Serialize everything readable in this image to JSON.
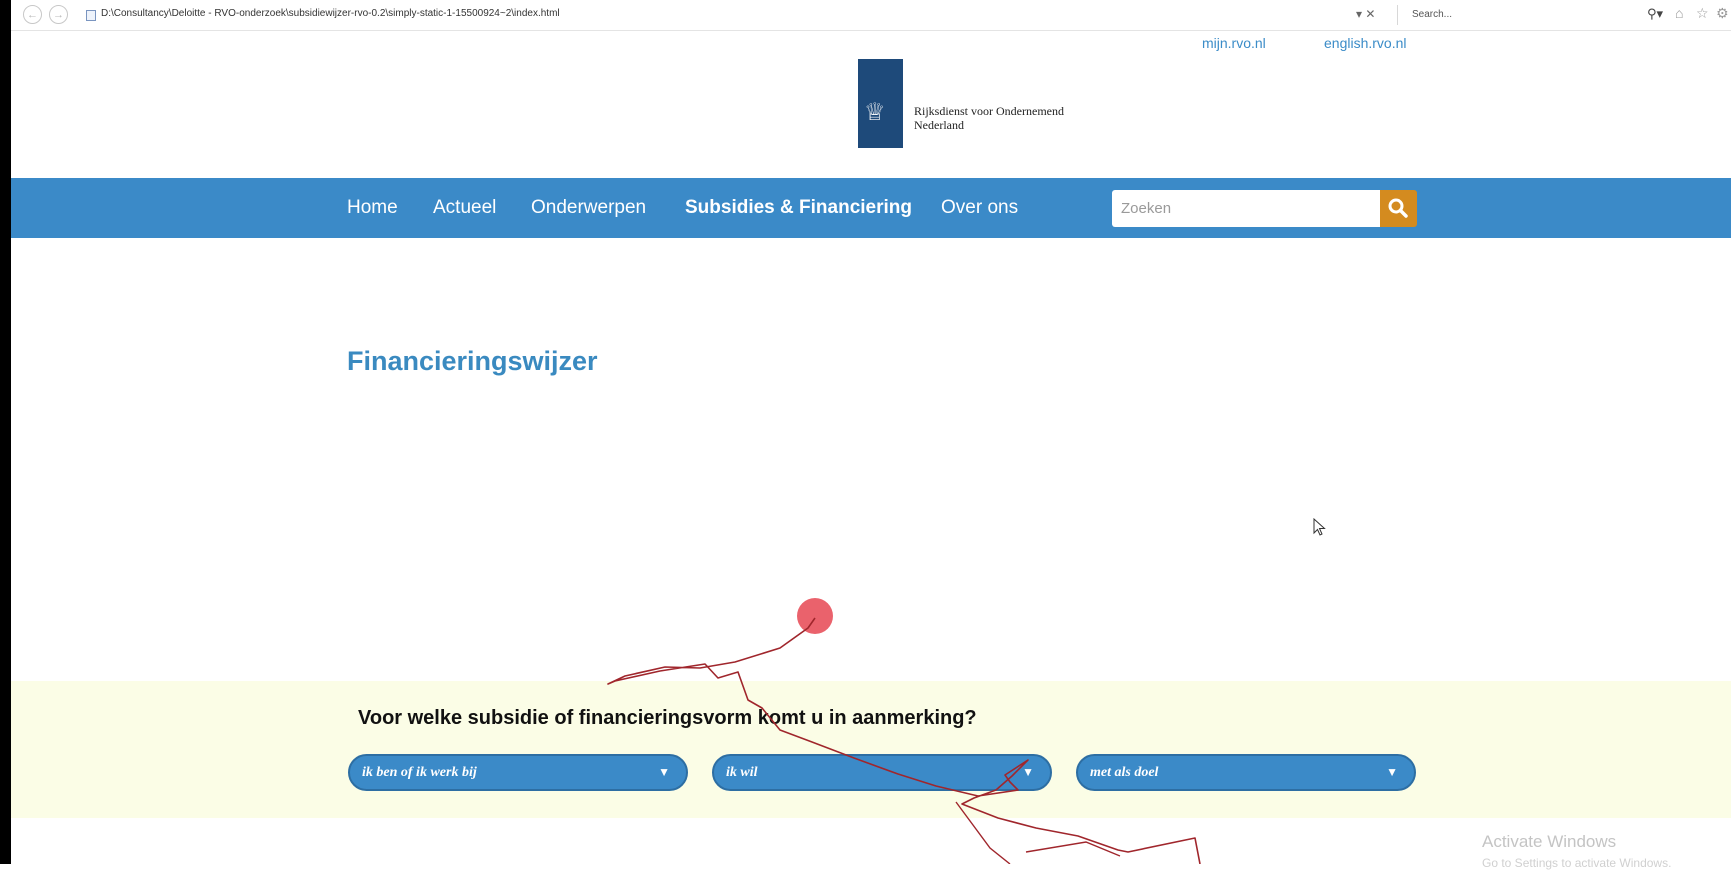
{
  "browser": {
    "address": "D:\\Consultancy\\Deloitte - RVO-onderzoek\\subsidiewijzer-rvo-0.2\\simply-static-1-15500924~2\\index.html",
    "address_controls": "▾ ✕",
    "search_placeholder": "Search...",
    "search_icon": "search-icon",
    "toolbar_icons": [
      "home-icon",
      "star-icon",
      "gear-icon"
    ]
  },
  "top_links": [
    "mijn.rvo.nl",
    "english.rvo.nl"
  ],
  "logo": {
    "line1": "Rijksdienst voor Ondernemend",
    "line2": "Nederland"
  },
  "nav": {
    "items": [
      "Home",
      "Actueel",
      "Onderwerpen",
      "Subsidies & Financiering",
      "Over ons"
    ],
    "active_index": 3,
    "search_placeholder": "Zoeken"
  },
  "content": {
    "title": "Financieringswijzer"
  },
  "wizard": {
    "question": "Voor welke subsidie of financieringsvorm komt u in aanmerking?",
    "dropdowns": [
      "ik ben of ik werk bij",
      "ik wil",
      "met als doel"
    ]
  },
  "watermark": {
    "line1": "Activate Windows",
    "line2": "Go to Settings to activate Windows."
  },
  "colors": {
    "brand_blue": "#3b8ac8",
    "search_button": "#d48b1f",
    "logo_blue": "#1e4a7a",
    "title_blue": "#3a8ac0",
    "band_bg": "#fbfde6",
    "annotation_red": "#e8555f"
  }
}
